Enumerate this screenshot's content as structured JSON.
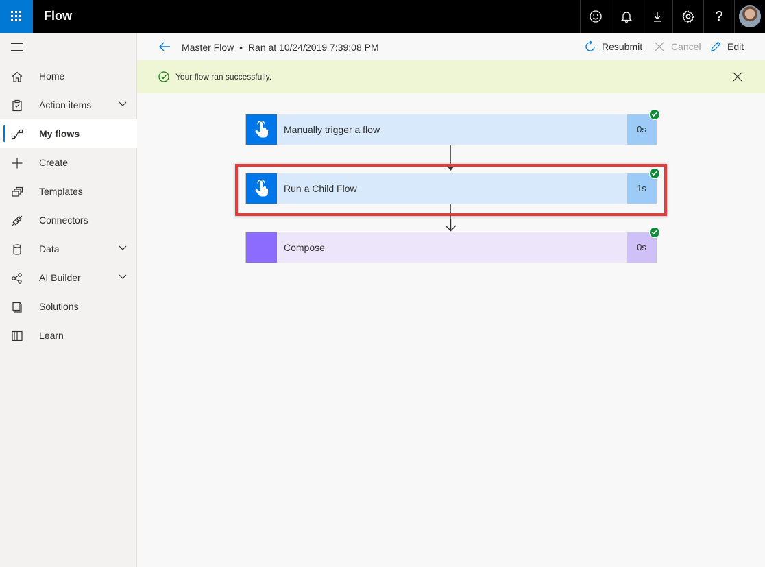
{
  "app": {
    "title": "Flow"
  },
  "topbar": {
    "icons": [
      "smiley-icon",
      "bell-icon",
      "download-icon",
      "gear-icon",
      "help-icon"
    ],
    "help_glyph": "?"
  },
  "sidebar": {
    "items": [
      {
        "label": "Home",
        "icon": "home-icon"
      },
      {
        "label": "Action items",
        "icon": "clipboard-icon",
        "expandable": true
      },
      {
        "label": "My flows",
        "icon": "flow-icon",
        "active": true
      },
      {
        "label": "Create",
        "icon": "plus-icon"
      },
      {
        "label": "Templates",
        "icon": "templates-icon"
      },
      {
        "label": "Connectors",
        "icon": "connector-icon"
      },
      {
        "label": "Data",
        "icon": "database-icon",
        "expandable": true
      },
      {
        "label": "AI Builder",
        "icon": "ai-builder-icon",
        "expandable": true
      },
      {
        "label": "Solutions",
        "icon": "solutions-icon"
      },
      {
        "label": "Learn",
        "icon": "book-icon"
      }
    ]
  },
  "command_bar": {
    "flow_name": "Master Flow",
    "separator": "•",
    "run_info": "Ran at 10/24/2019 7:39:08 PM",
    "resubmit_label": "Resubmit",
    "cancel_label": "Cancel",
    "edit_label": "Edit"
  },
  "banner": {
    "message": "Your flow ran successfully."
  },
  "steps": [
    {
      "title": "Manually trigger a flow",
      "duration": "0s",
      "status": "succeeded",
      "color": "#0077e8"
    },
    {
      "title": "Run a Child Flow",
      "duration": "1s",
      "status": "succeeded",
      "color": "#0077e8",
      "highlighted": true
    },
    {
      "title": "Compose",
      "duration": "0s",
      "status": "succeeded",
      "color": "#8c6cff"
    }
  ],
  "colors": {
    "accent": "#0078d4",
    "success": "#118a3b",
    "highlight": "#e83b3b",
    "banner": "#eff6d6"
  }
}
